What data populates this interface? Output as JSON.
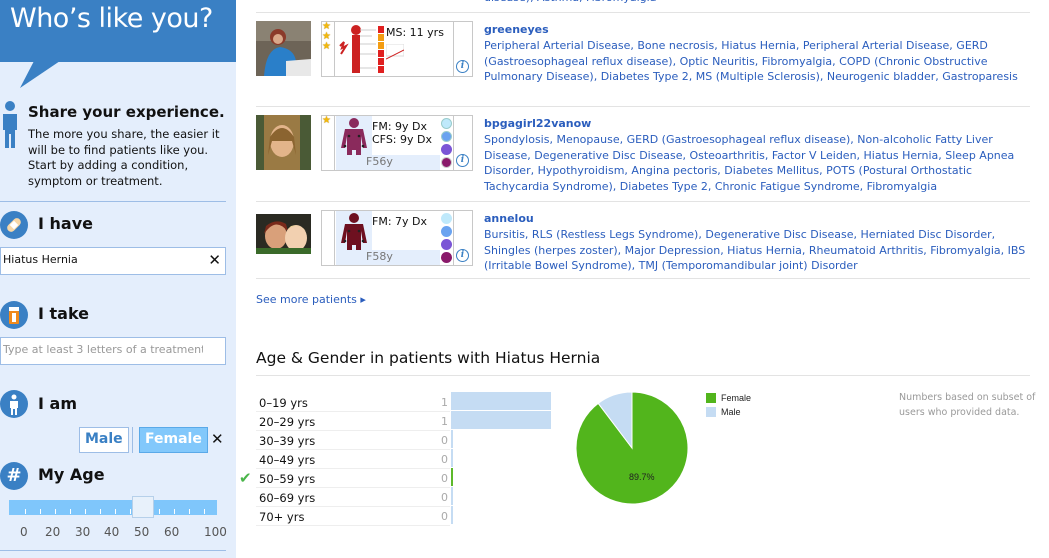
{
  "sidebar": {
    "banner_title": "Who’s like you?",
    "share_title": "Share your experience.",
    "share_text": "The more you share, the easier it will be to find patients like you. Start by adding a condition, symptom or treatment.",
    "have_label": "I have",
    "have_value": "Hiatus Hernia",
    "take_label": "I take",
    "take_placeholder": "Type at least 3 letters of a treatment",
    "am_label": "I am",
    "gender_options": [
      "Male",
      "Female"
    ],
    "gender_selected": "Female",
    "age_label": "My Age",
    "age_value": 50,
    "age_scale": [
      "0",
      "20",
      "30",
      "40",
      "50",
      "60",
      "100"
    ],
    "clear_glyph": "✕"
  },
  "top_cut_text": "disease), Asthma, Fibromyalgia",
  "patients": [
    {
      "username": "greeneyes",
      "stars": 3,
      "dx": [
        "MS: 11 yrs"
      ],
      "demo": "",
      "figure_color": "#cc2222",
      "conditions": "Peripheral Arterial Disease, Bone necrosis, Hiatus Hernia, Peripheral Arterial Disease, GERD (Gastroesophageal reflux disease), Optic Neuritis, Fibromyalgia, COPD (Chronic Obstructive Pulmonary Disease), Diabetes Type 2, MS (Multiple Sclerosis), Neurogenic bladder, Gastroparesis"
    },
    {
      "username": "bpgagirl22vanow",
      "stars": 1,
      "dx": [
        "FM: 9y Dx",
        "CFS: 9y Dx"
      ],
      "demo": "F56y",
      "figure_color": "#8a2a5c",
      "conditions": "Spondylosis, Menopause, GERD (Gastroesophageal reflux disease), Non-alcoholic Fatty Liver Disease, Degenerative Disc Disease, Osteoarthritis, Factor V Leiden, Hiatus Hernia, Sleep Apnea Disorder, Hypothyroidism, Angina pectoris, Diabetes Mellitus, POTS (Postural Orthostatic Tachycardia Syndrome), Diabetes Type 2, Chronic Fatigue Syndrome, Fibromyalgia"
    },
    {
      "username": "annelou",
      "stars": 0,
      "dx": [
        "FM: 7y Dx"
      ],
      "demo": "F58y",
      "figure_color": "#6e1020",
      "conditions": "Bursitis, RLS (Restless Legs Syndrome), Degenerative Disc Disease, Herniated Disc Disorder, Shingles (herpes zoster), Major Depression, Hiatus Hernia, Rheumatoid Arthritis, Fibromyalgia, IBS (Irritable Bowel Syndrome), TMJ (Temporomandibular joint) Disorder"
    }
  ],
  "see_more": "See more patients ▸",
  "section_title": "Age & Gender in patients with Hiatus Hernia",
  "note": "Numbers based on subset of users who provided data.",
  "chart_data": [
    {
      "type": "bar",
      "title": "Age",
      "categories": [
        "0–19 yrs",
        "20–29 yrs",
        "30–39 yrs",
        "40–49 yrs",
        "50–59 yrs",
        "60–69 yrs",
        "70+ yrs"
      ],
      "values": [
        1,
        1,
        0,
        0,
        0,
        0,
        0
      ],
      "highlighted": "50–59 yrs",
      "orientation": "horizontal",
      "color": "#c5dcf3",
      "highlight_color": "#5db92b"
    },
    {
      "type": "pie",
      "title": "Gender",
      "labels": [
        "Female",
        "Male"
      ],
      "values": [
        89.7,
        10.3
      ],
      "colors": [
        "#52b51c",
        "#c5dcf3"
      ],
      "data_labels": [
        "89.7%",
        ""
      ],
      "legend": "right"
    }
  ]
}
